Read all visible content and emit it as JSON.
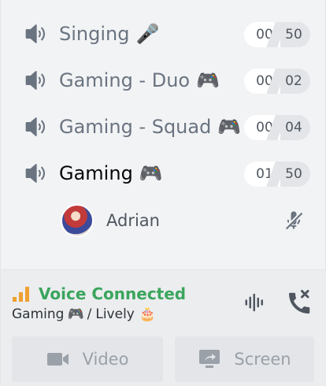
{
  "channels": [
    {
      "name": "Singing",
      "emoji": "🎤",
      "current": "00",
      "max": "50"
    },
    {
      "name": "Gaming - Duo",
      "emoji": "🎮",
      "current": "00",
      "max": "02"
    },
    {
      "name": "Gaming - Squad",
      "emoji": "🎮",
      "current": "00",
      "max": "04"
    },
    {
      "name": "Gaming",
      "emoji": "🎮",
      "current": "01",
      "max": "50"
    }
  ],
  "voice_user": {
    "name": "Adrian"
  },
  "voice_status": {
    "title": "Voice Connected",
    "channel": "Gaming",
    "channel_emoji": "🎮",
    "separator": "/",
    "server": "Lively",
    "server_emoji": "🎂"
  },
  "buttons": {
    "video": "Video",
    "screen": "Screen"
  },
  "colors": {
    "connected": "#3ba55d",
    "signal": "#f0a030",
    "muted_text": "#6a7480"
  }
}
